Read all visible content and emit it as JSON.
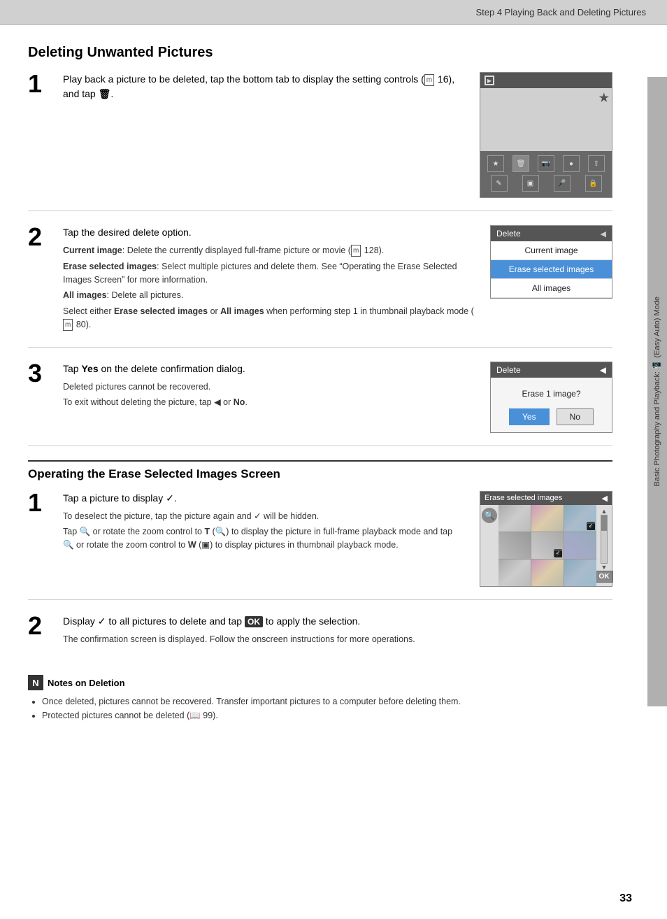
{
  "header": {
    "title": "Step 4 Playing Back and Deleting Pictures"
  },
  "sidebar": {
    "text": "Basic Photography and Playback: 📷 (Easy Auto) Mode"
  },
  "section1": {
    "title": "Deleting Unwanted Pictures",
    "steps": [
      {
        "number": "1",
        "text": "Play back a picture to be deleted, tap the bottom tab to display the setting controls (📖 16), and tap 🗑.",
        "image_alt": "camera playback controls screenshot"
      },
      {
        "number": "2",
        "title": "Tap the desired delete option.",
        "subtext_1_label": "Current image",
        "subtext_1": ": Delete the currently displayed full-frame picture or movie (📖 128).",
        "subtext_2_label": "Erase selected images",
        "subtext_2": ": Select multiple pictures and delete them. See “Operating the Erase Selected Images Screen” for more information.",
        "subtext_3_label": "All images",
        "subtext_3": ": Delete all pictures.",
        "subtext_4": "Select either ",
        "subtext_4b": "Erase selected images",
        "subtext_4c": " or ",
        "subtext_4d": "All images",
        "subtext_4e": " when performing step 1 in thumbnail playback mode (📖 80).",
        "menu_title": "Delete",
        "menu_items": [
          "Current image",
          "Erase selected images",
          "All images"
        ]
      },
      {
        "number": "3",
        "title_prefix": "Tap ",
        "title_bold": "Yes",
        "title_suffix": " on the delete confirmation dialog.",
        "sub1": "Deleted pictures cannot be recovered.",
        "sub2_prefix": "To exit without deleting the picture, tap ",
        "sub2_icon": "■",
        "sub2_suffix": " or ",
        "sub2_bold": "No",
        "sub2_end": ".",
        "dialog_title": "Delete",
        "dialog_text": "Erase 1 image?",
        "btn_yes": "Yes",
        "btn_no": "No"
      }
    ]
  },
  "section2": {
    "title": "Operating the Erase Selected Images Screen",
    "steps": [
      {
        "number": "1",
        "text_prefix": "Tap a picture to display ",
        "text_icon": "✓",
        "text_suffix": ".",
        "sub1_prefix": "To deselect the picture, tap the picture again and ",
        "sub1_icon": "✓",
        "sub1_suffix": " will be hidden.",
        "sub2_prefix": "Tap ",
        "sub2_icon_q": "🔍",
        "sub2_mid": " or rotate the zoom control to ",
        "sub2_bold_T": "T",
        "sub2_paren": "(🔍)",
        "sub2_rest": " to display the picture in full-frame playback mode and tap ",
        "sub2_icon_q2": "🔍",
        "sub2_mid2": " or rotate the zoom control to ",
        "sub2_bold_W": "W",
        "sub2_paren2": "(▣)",
        "sub2_rest2": " to display pictures in thumbnail playback mode.",
        "ui_header": "Erase selected images"
      },
      {
        "number": "2",
        "text_prefix": "Display ",
        "text_icon": "✓",
        "text_mid": " to all pictures to delete and tap ",
        "text_ok": "OK",
        "text_suffix": " to apply the selection.",
        "sub1": "The confirmation screen is displayed. Follow the onscreen instructions for more operations."
      }
    ]
  },
  "notes": {
    "title": "Notes on Deletion",
    "icon": "N",
    "items": [
      "Once deleted, pictures cannot be recovered. Transfer important pictures to a computer before deleting them.",
      "Protected pictures cannot be deleted (📖 99)."
    ]
  },
  "page_number": "33"
}
